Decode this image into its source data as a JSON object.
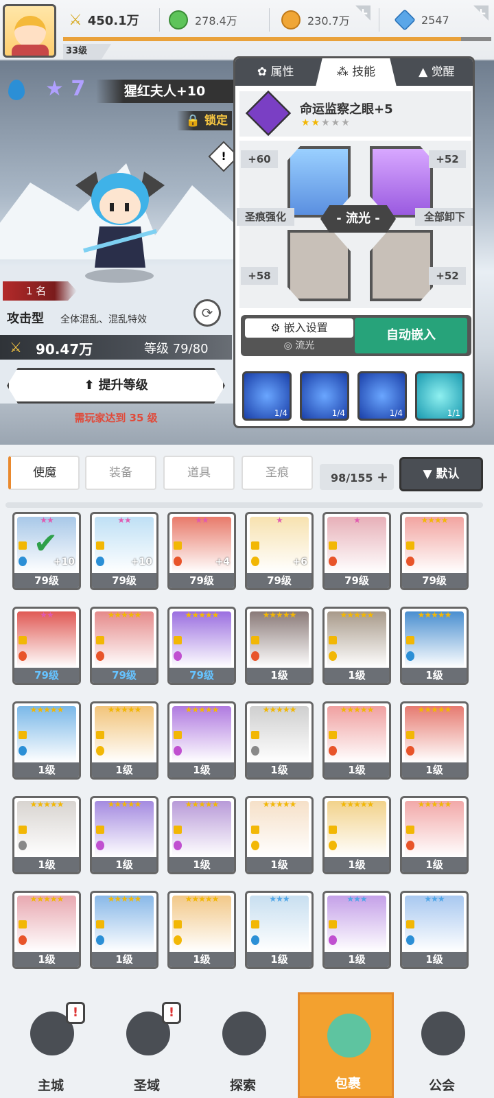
{
  "header": {
    "player_level": "33级",
    "power": "450.1万",
    "resources": [
      {
        "icon": "green-orb-icon",
        "value": "278.4万",
        "color": "#5ec45a"
      },
      {
        "icon": "gold-coin-icon",
        "value": "230.7万",
        "color": "#f0a636"
      },
      {
        "icon": "blue-crystal-icon",
        "value": "2547",
        "color": "#5aa6e8"
      }
    ],
    "xp_progress": 0.93
  },
  "hero": {
    "stars": "7",
    "name": "猩红夫人+10",
    "lock_label": "锁定",
    "rank": "1 名",
    "rank_icon": "热",
    "type": "攻击型",
    "type_desc": "全体混乱、混乱特效",
    "power": "90.47万",
    "level": "等级 79/80",
    "upgrade_label": "提升等级",
    "requirement": "需玩家达到 35 级"
  },
  "panel": {
    "tabs": [
      "属性",
      "技能",
      "觉醒"
    ],
    "active_tab": "技能",
    "skill_name": "命运监察之眼+5",
    "skill_stars_on": "★★",
    "skill_stars_off": "★★★",
    "socket_values": [
      "+60",
      "+52",
      "+58",
      "+52"
    ],
    "left_plate": "圣痕强化",
    "right_plate": "全部卸下",
    "core_label": "- 流光 -",
    "embed_setting": "嵌入设置",
    "embed_sub": "流光",
    "auto_embed": "自动嵌入",
    "runes": [
      "1/4",
      "1/4",
      "1/4",
      "1/1"
    ]
  },
  "inventory": {
    "tabs": [
      "使魔",
      "装备",
      "道具",
      "圣痕"
    ],
    "capacity": "98/155",
    "sort_label": "▼ 默认",
    "cards": [
      {
        "stars": "★★",
        "level": "79级",
        "plus": "+10",
        "elem": "#2b8fd6",
        "color": "#a8c8e8",
        "checked": true
      },
      {
        "stars": "★★",
        "level": "79级",
        "plus": "+10",
        "elem": "#2b8fd6",
        "color": "#bfe0f5"
      },
      {
        "stars": "★★",
        "level": "79级",
        "plus": "+4",
        "elem": "#e8542a",
        "color": "#e87a6a"
      },
      {
        "stars": "★",
        "level": "79级",
        "plus": "+6",
        "elem": "#f2b705",
        "color": "#f7e2b0"
      },
      {
        "stars": "★",
        "level": "79级",
        "plus": "",
        "elem": "#e8542a",
        "color": "#e7b0b8"
      },
      {
        "stars": "★★★★",
        "level": "79级",
        "plus": "",
        "elem": "#e8542a",
        "color": "#f2a4a0"
      },
      {
        "stars": "★★",
        "level": "79级",
        "plus": "",
        "elem": "#e8542a",
        "color": "#e05a55",
        "blue": true
      },
      {
        "stars": "★★★★★",
        "level": "79级",
        "plus": "",
        "elem": "#e8542a",
        "color": "#e58a8a",
        "blue": true
      },
      {
        "stars": "★★★★★",
        "level": "79级",
        "plus": "",
        "elem": "#c050d0",
        "color": "#9b6fe0",
        "blue": true
      },
      {
        "stars": "★★★★★",
        "level": "1级",
        "plus": "",
        "elem": "#e8542a",
        "color": "#8a7a78"
      },
      {
        "stars": "★★★★★",
        "level": "1级",
        "plus": "",
        "elem": "#f2b705",
        "color": "#a89a8a"
      },
      {
        "stars": "★★★★★",
        "level": "1级",
        "plus": "",
        "elem": "#2b8fd6",
        "color": "#4a8fd0"
      },
      {
        "stars": "★★★★★",
        "level": "1级",
        "plus": "",
        "elem": "#2b8fd6",
        "color": "#7ab8e8"
      },
      {
        "stars": "★★★★★",
        "level": "1级",
        "plus": "",
        "elem": "#f2b705",
        "color": "#f2c47a"
      },
      {
        "stars": "★★★★★",
        "level": "1级",
        "plus": "",
        "elem": "#c050d0",
        "color": "#b07ae0"
      },
      {
        "stars": "★★★★★",
        "level": "1级",
        "plus": "",
        "elem": "#888888",
        "color": "#cfcfcf"
      },
      {
        "stars": "★★★★★",
        "level": "1级",
        "plus": "",
        "elem": "#e8542a",
        "color": "#f0a0a0"
      },
      {
        "stars": "★★★★★",
        "level": "1级",
        "plus": "",
        "elem": "#e8542a",
        "color": "#e67a70"
      },
      {
        "stars": "★★★★★",
        "level": "1级",
        "plus": "",
        "elem": "#888888",
        "color": "#d8d4d0"
      },
      {
        "stars": "★★★★★",
        "level": "1级",
        "plus": "",
        "elem": "#c050d0",
        "color": "#a48ae0"
      },
      {
        "stars": "★★★★★",
        "level": "1级",
        "plus": "",
        "elem": "#c050d0",
        "color": "#b89ad8"
      },
      {
        "stars": "★★★★★",
        "level": "1级",
        "plus": "",
        "elem": "#f2b705",
        "color": "#f6e0c8"
      },
      {
        "stars": "★★★★★",
        "level": "1级",
        "plus": "",
        "elem": "#f2b705",
        "color": "#f2d28a"
      },
      {
        "stars": "★★★★★",
        "level": "1级",
        "plus": "",
        "elem": "#e8542a",
        "color": "#f2a8a8"
      },
      {
        "stars": "★★★★★",
        "level": "1级",
        "plus": "",
        "elem": "#e8542a",
        "color": "#e8a8b0"
      },
      {
        "stars": "★★★★★",
        "level": "1级",
        "plus": "",
        "elem": "#2b8fd6",
        "color": "#88b8e8"
      },
      {
        "stars": "★★★★★",
        "level": "1级",
        "plus": "",
        "elem": "#f2b705",
        "color": "#f2c888"
      },
      {
        "stars": "★★★",
        "level": "1级",
        "plus": "",
        "elem": "#2b8fd6",
        "color": "#c8dff0",
        "blue_stars": true
      },
      {
        "stars": "★★★",
        "level": "1级",
        "plus": "",
        "elem": "#c050d0",
        "color": "#c4a0e8",
        "blue_stars": true
      },
      {
        "stars": "★★★",
        "level": "1级",
        "plus": "",
        "elem": "#2b8fd6",
        "color": "#a8c8f0",
        "blue_stars": true
      }
    ]
  },
  "nav": {
    "items": [
      {
        "label": "主城",
        "icon": "castle-icon",
        "badge": "!"
      },
      {
        "label": "圣域",
        "icon": "portal-icon",
        "badge": "!"
      },
      {
        "label": "探索",
        "icon": "sword-icon",
        "badge": ""
      },
      {
        "label": "包裹",
        "icon": "bag-icon",
        "badge": ""
      },
      {
        "label": "公会",
        "icon": "guild-icon",
        "badge": ""
      }
    ],
    "active": "包裹"
  }
}
